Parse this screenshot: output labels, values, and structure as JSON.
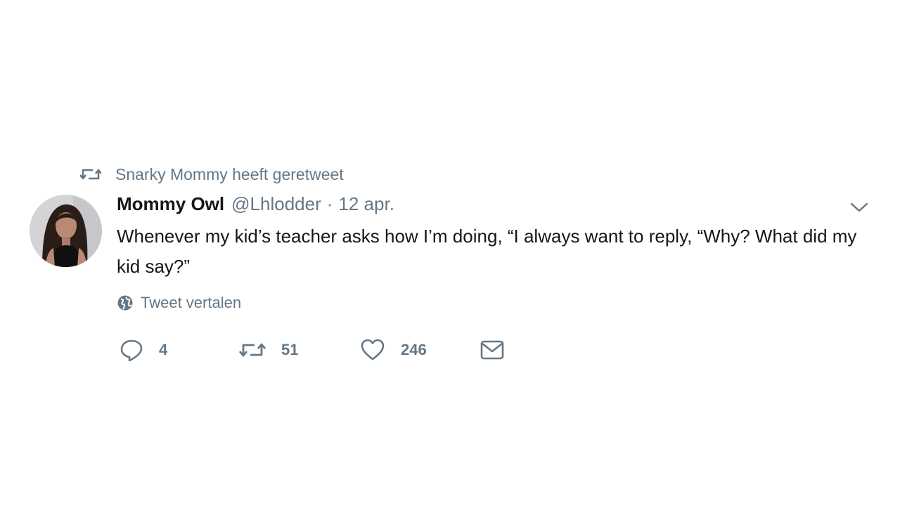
{
  "retweet_context": {
    "text": "Snarky Mommy heeft geretweet"
  },
  "author": {
    "display_name": "Mommy Owl",
    "handle": "@Lhlodder",
    "separator": "·",
    "date": "12 apr."
  },
  "tweet": {
    "text": "Whenever my kid’s teacher asks how I’m doing, “I always want to reply, “Why? What did my kid say?”"
  },
  "translate": {
    "label": "Tweet vertalen"
  },
  "actions": {
    "reply_count": "4",
    "retweet_count": "51",
    "like_count": "246"
  },
  "icons": {
    "retweet": "retweet-icon",
    "caret": "chevron-down-icon",
    "globe": "globe-icon",
    "reply": "reply-icon",
    "like": "heart-icon",
    "dm": "envelope-icon"
  },
  "colors": {
    "text_primary": "#14171a",
    "text_secondary": "#657786",
    "background": "#ffffff"
  }
}
